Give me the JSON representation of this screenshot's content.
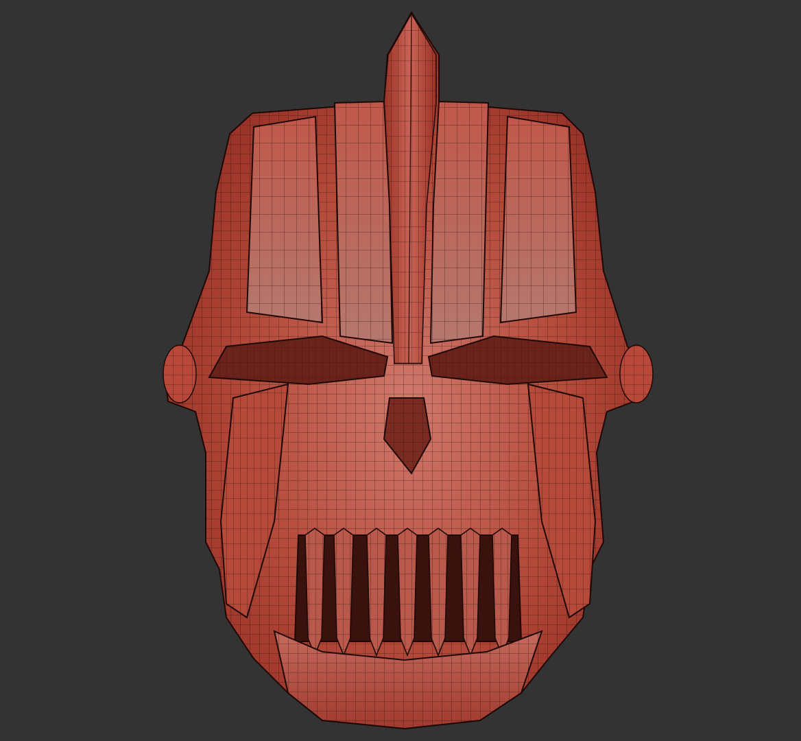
{
  "viewport": {
    "background": "#333333",
    "subject": "helmet-mesh-wireframe"
  },
  "palette": {
    "shell_light": "#c9685c",
    "shell_mid": "#b44636",
    "shell_dark": "#8f2a20",
    "wire": "#2a0d0a",
    "cavity": "#5a1a14"
  }
}
